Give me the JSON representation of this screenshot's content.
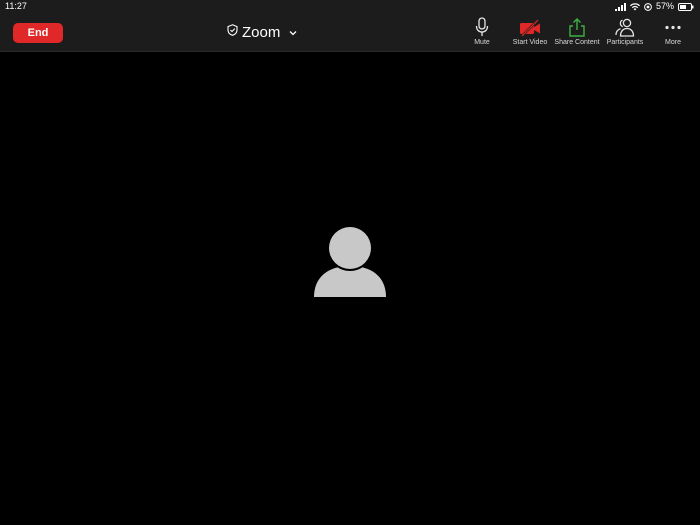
{
  "status_bar": {
    "time": "11:27",
    "battery_percent": "57%"
  },
  "toolbar": {
    "end_label": "End",
    "meeting_title": "Zoom",
    "buttons": [
      {
        "label": "Mute",
        "icon": "microphone-icon"
      },
      {
        "label": "Start Video",
        "icon": "video-off-icon"
      },
      {
        "label": "Share Content",
        "icon": "share-up-arrow-icon"
      },
      {
        "label": "Participants",
        "icon": "participants-icon"
      },
      {
        "label": "More",
        "icon": "more-dots-icon"
      }
    ]
  },
  "colors": {
    "end_red": "#e02828",
    "video_off_red": "#e02828",
    "share_green": "#3cb043",
    "avatar_gray": "#c8c8c8",
    "toolbar_bg": "#1c1c1c"
  }
}
